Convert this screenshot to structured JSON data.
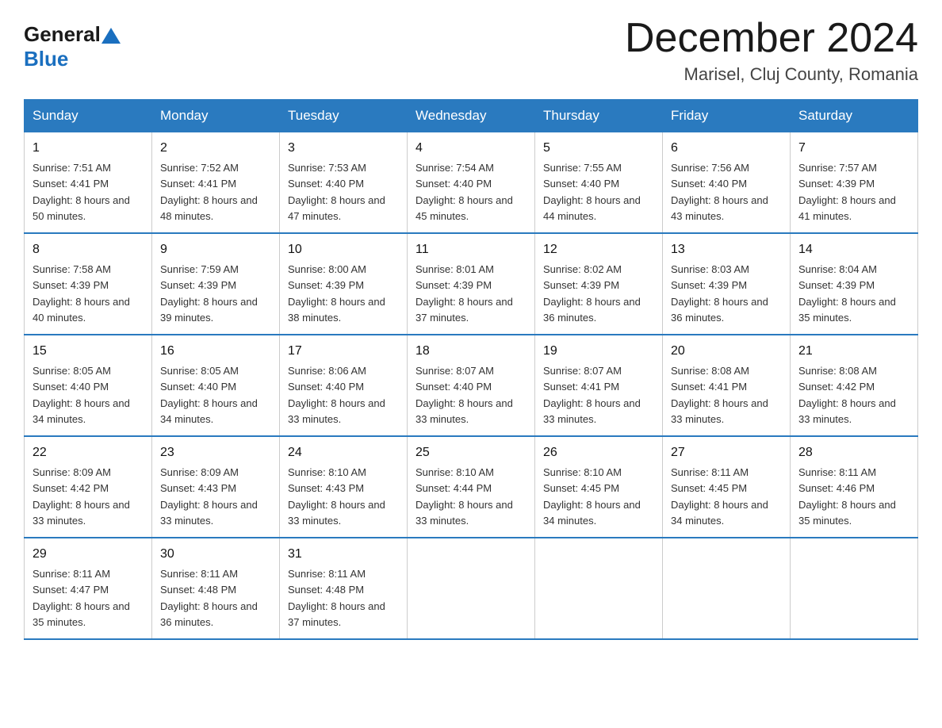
{
  "logo": {
    "general": "General",
    "blue": "Blue"
  },
  "title": {
    "month": "December 2024",
    "location": "Marisel, Cluj County, Romania"
  },
  "days_header": [
    "Sunday",
    "Monday",
    "Tuesday",
    "Wednesday",
    "Thursday",
    "Friday",
    "Saturday"
  ],
  "weeks": [
    [
      {
        "day": "1",
        "sunrise": "7:51 AM",
        "sunset": "4:41 PM",
        "daylight": "8 hours and 50 minutes."
      },
      {
        "day": "2",
        "sunrise": "7:52 AM",
        "sunset": "4:41 PM",
        "daylight": "8 hours and 48 minutes."
      },
      {
        "day": "3",
        "sunrise": "7:53 AM",
        "sunset": "4:40 PM",
        "daylight": "8 hours and 47 minutes."
      },
      {
        "day": "4",
        "sunrise": "7:54 AM",
        "sunset": "4:40 PM",
        "daylight": "8 hours and 45 minutes."
      },
      {
        "day": "5",
        "sunrise": "7:55 AM",
        "sunset": "4:40 PM",
        "daylight": "8 hours and 44 minutes."
      },
      {
        "day": "6",
        "sunrise": "7:56 AM",
        "sunset": "4:40 PM",
        "daylight": "8 hours and 43 minutes."
      },
      {
        "day": "7",
        "sunrise": "7:57 AM",
        "sunset": "4:39 PM",
        "daylight": "8 hours and 41 minutes."
      }
    ],
    [
      {
        "day": "8",
        "sunrise": "7:58 AM",
        "sunset": "4:39 PM",
        "daylight": "8 hours and 40 minutes."
      },
      {
        "day": "9",
        "sunrise": "7:59 AM",
        "sunset": "4:39 PM",
        "daylight": "8 hours and 39 minutes."
      },
      {
        "day": "10",
        "sunrise": "8:00 AM",
        "sunset": "4:39 PM",
        "daylight": "8 hours and 38 minutes."
      },
      {
        "day": "11",
        "sunrise": "8:01 AM",
        "sunset": "4:39 PM",
        "daylight": "8 hours and 37 minutes."
      },
      {
        "day": "12",
        "sunrise": "8:02 AM",
        "sunset": "4:39 PM",
        "daylight": "8 hours and 36 minutes."
      },
      {
        "day": "13",
        "sunrise": "8:03 AM",
        "sunset": "4:39 PM",
        "daylight": "8 hours and 36 minutes."
      },
      {
        "day": "14",
        "sunrise": "8:04 AM",
        "sunset": "4:39 PM",
        "daylight": "8 hours and 35 minutes."
      }
    ],
    [
      {
        "day": "15",
        "sunrise": "8:05 AM",
        "sunset": "4:40 PM",
        "daylight": "8 hours and 34 minutes."
      },
      {
        "day": "16",
        "sunrise": "8:05 AM",
        "sunset": "4:40 PM",
        "daylight": "8 hours and 34 minutes."
      },
      {
        "day": "17",
        "sunrise": "8:06 AM",
        "sunset": "4:40 PM",
        "daylight": "8 hours and 33 minutes."
      },
      {
        "day": "18",
        "sunrise": "8:07 AM",
        "sunset": "4:40 PM",
        "daylight": "8 hours and 33 minutes."
      },
      {
        "day": "19",
        "sunrise": "8:07 AM",
        "sunset": "4:41 PM",
        "daylight": "8 hours and 33 minutes."
      },
      {
        "day": "20",
        "sunrise": "8:08 AM",
        "sunset": "4:41 PM",
        "daylight": "8 hours and 33 minutes."
      },
      {
        "day": "21",
        "sunrise": "8:08 AM",
        "sunset": "4:42 PM",
        "daylight": "8 hours and 33 minutes."
      }
    ],
    [
      {
        "day": "22",
        "sunrise": "8:09 AM",
        "sunset": "4:42 PM",
        "daylight": "8 hours and 33 minutes."
      },
      {
        "day": "23",
        "sunrise": "8:09 AM",
        "sunset": "4:43 PM",
        "daylight": "8 hours and 33 minutes."
      },
      {
        "day": "24",
        "sunrise": "8:10 AM",
        "sunset": "4:43 PM",
        "daylight": "8 hours and 33 minutes."
      },
      {
        "day": "25",
        "sunrise": "8:10 AM",
        "sunset": "4:44 PM",
        "daylight": "8 hours and 33 minutes."
      },
      {
        "day": "26",
        "sunrise": "8:10 AM",
        "sunset": "4:45 PM",
        "daylight": "8 hours and 34 minutes."
      },
      {
        "day": "27",
        "sunrise": "8:11 AM",
        "sunset": "4:45 PM",
        "daylight": "8 hours and 34 minutes."
      },
      {
        "day": "28",
        "sunrise": "8:11 AM",
        "sunset": "4:46 PM",
        "daylight": "8 hours and 35 minutes."
      }
    ],
    [
      {
        "day": "29",
        "sunrise": "8:11 AM",
        "sunset": "4:47 PM",
        "daylight": "8 hours and 35 minutes."
      },
      {
        "day": "30",
        "sunrise": "8:11 AM",
        "sunset": "4:48 PM",
        "daylight": "8 hours and 36 minutes."
      },
      {
        "day": "31",
        "sunrise": "8:11 AM",
        "sunset": "4:48 PM",
        "daylight": "8 hours and 37 minutes."
      },
      null,
      null,
      null,
      null
    ]
  ],
  "labels": {
    "sunrise": "Sunrise: ",
    "sunset": "Sunset: ",
    "daylight": "Daylight: "
  }
}
